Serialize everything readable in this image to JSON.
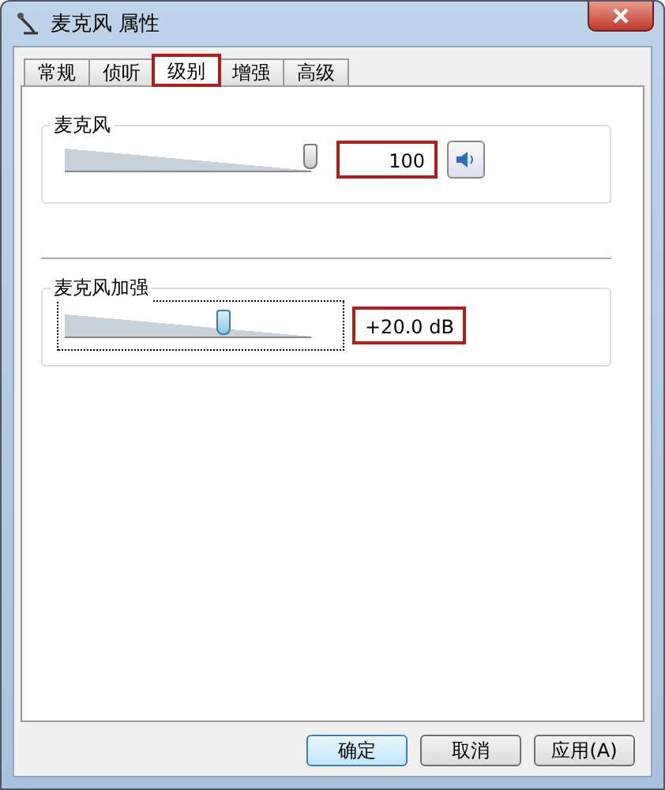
{
  "window": {
    "title": "麦克风 属性"
  },
  "tabs": [
    {
      "label": "常规",
      "selected": false,
      "highlighted": false
    },
    {
      "label": "侦听",
      "selected": false,
      "highlighted": false
    },
    {
      "label": "级别",
      "selected": true,
      "highlighted": true
    },
    {
      "label": "增强",
      "selected": false,
      "highlighted": false
    },
    {
      "label": "高级",
      "selected": false,
      "highlighted": false
    }
  ],
  "groups": [
    {
      "title": "麦克风",
      "level": 1,
      "value": "100",
      "highlighted": true,
      "mute_button": true,
      "focused": false
    },
    {
      "title": "麦克风加强",
      "level": 0.65,
      "value": "+20.0 dB",
      "highlighted": true,
      "mute_button": false,
      "focused": true
    }
  ],
  "buttons": [
    {
      "label": "确定",
      "default": true
    },
    {
      "label": "取消",
      "default": false
    },
    {
      "label": "应用(A)",
      "default": false
    }
  ]
}
